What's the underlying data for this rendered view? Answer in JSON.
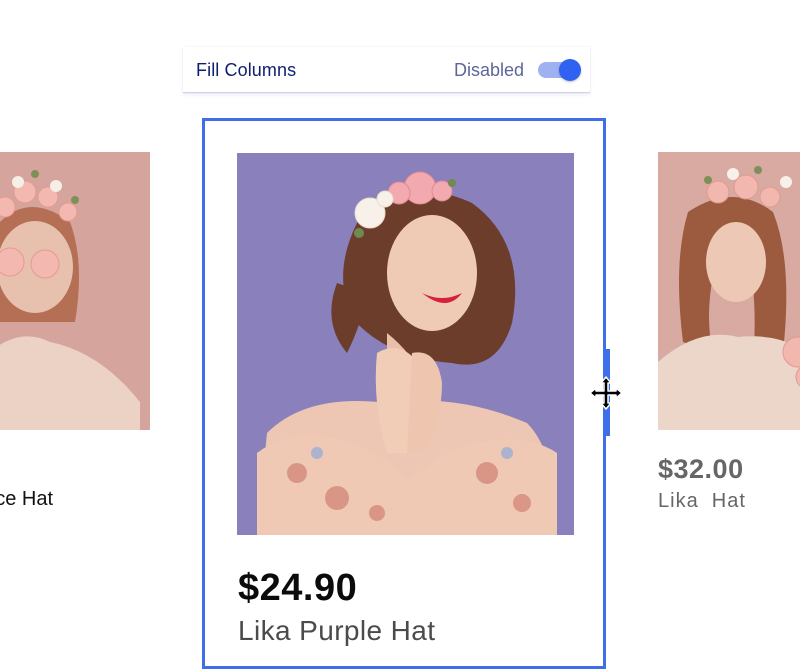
{
  "toolbar": {
    "label": "Fill Columns",
    "status": "Disabled",
    "toggle_on": true
  },
  "products": {
    "left": {
      "name": "Lika Lace Hat"
    },
    "main": {
      "price": "$24.90",
      "name": "Lika Purple Hat"
    },
    "right": {
      "price": "$32.00",
      "name": "Lika  Hat"
    }
  },
  "colors": {
    "accent": "#3f6fe8",
    "toggle_track": "#9fb1f0",
    "toggle_knob": "#2f62f0",
    "label_text": "#0f1f6e",
    "photo_bg_main": "#8a80bb",
    "photo_bg_side": "#d4a39c"
  },
  "icons": {
    "cursor": "move-cursor-icon"
  }
}
